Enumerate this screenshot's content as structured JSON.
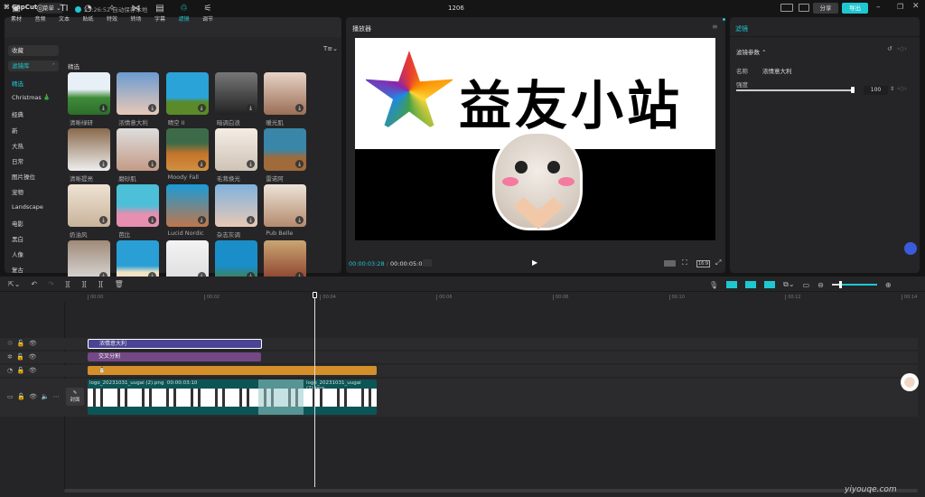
{
  "app": {
    "logo": "CapCut",
    "menu": "菜单",
    "autosave": "23:26:52 自动保存本地",
    "project_title": "1206",
    "share": "分享",
    "export": "导出",
    "accent": "#1fc7d1"
  },
  "toolbar": [
    {
      "icon": "media-icon",
      "label": "素材"
    },
    {
      "icon": "audio-icon",
      "label": "音频"
    },
    {
      "icon": "text-icon",
      "label": "文本"
    },
    {
      "icon": "sticker-icon",
      "label": "贴纸"
    },
    {
      "icon": "effects-icon",
      "label": "特效"
    },
    {
      "icon": "transition-icon",
      "label": "转场"
    },
    {
      "icon": "caption-icon",
      "label": "字幕"
    },
    {
      "icon": "filter-icon",
      "label": "滤镜"
    },
    {
      "icon": "adjust-icon",
      "label": "调节"
    }
  ],
  "sidebar": {
    "favorites": "收藏",
    "library": "滤镜库",
    "items": [
      "精选",
      "Christmas 🎄",
      "经典",
      "新",
      "大热",
      "日常",
      "图片操位",
      "宠物",
      "Landscape",
      "电影",
      "黑白",
      "人像",
      "复古"
    ]
  },
  "grid": {
    "section": "精选",
    "items": [
      "清晰绿研",
      "浓情意大利",
      "晴空 II",
      "暗调白浪",
      "暖光肌",
      "清晰提亮",
      "磨砂肌",
      "Moody Fall",
      "毛茸焕光",
      "雷诺阿",
      "奶油风",
      "芭比",
      "Lucid Nordic",
      "杂志灰调",
      "Pub Belle",
      "",
      "",
      "",
      "",
      ""
    ]
  },
  "player": {
    "title": "播放器",
    "current_time": "00:00:03:28",
    "total_time": "00:00:05:00",
    "ratio": "16:9",
    "watermark_text": "益友小站"
  },
  "inspector": {
    "tab": "滤镜",
    "section": "滤镜参数",
    "name_label": "名称",
    "name_value": "浓情意大利",
    "intensity_label": "强度",
    "intensity_value": "100",
    "intensity_fraction": 1.0
  },
  "timeline": {
    "ruler": [
      "00:00",
      "00:02",
      "00:04",
      "00:06",
      "00:08",
      "00:10",
      "00:12",
      "00:14"
    ],
    "filter_clip": "浓情意大利",
    "effect_clip": "交叉分割",
    "cover_label": "封面",
    "clip1_name": "logo_20231031_uugai (2).png",
    "clip1_duration": "00:00:03:10",
    "clip2_name": "logo_20231031_uugai (2).png"
  },
  "watermark": "yiyouqe.com"
}
